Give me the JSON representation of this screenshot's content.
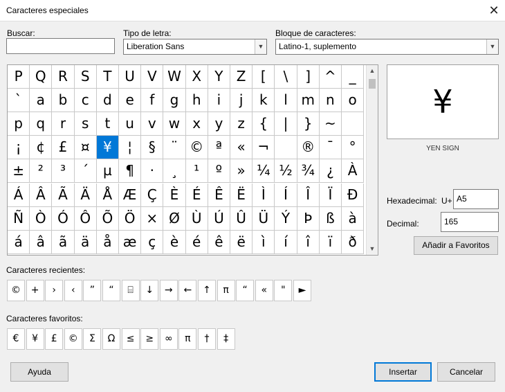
{
  "window": {
    "title": "Caracteres especiales"
  },
  "search": {
    "label": "Buscar:",
    "value": ""
  },
  "font": {
    "label": "Tipo de letra:",
    "value": "Liberation Sans"
  },
  "block": {
    "label": "Bloque de caracteres:",
    "value": "Latino-1, suplemento"
  },
  "grid": {
    "rows": [
      [
        "P",
        "Q",
        "R",
        "S",
        "T",
        "U",
        "V",
        "W",
        "X",
        "Y",
        "Z",
        "[",
        "\\",
        "]",
        "^",
        "_"
      ],
      [
        "`",
        "a",
        "b",
        "c",
        "d",
        "e",
        "f",
        "g",
        "h",
        "i",
        "j",
        "k",
        "l",
        "m",
        "n",
        "o"
      ],
      [
        "p",
        "q",
        "r",
        "s",
        "t",
        "u",
        "v",
        "w",
        "x",
        "y",
        "z",
        "{",
        "|",
        "}",
        "~",
        ""
      ],
      [
        "¡",
        "¢",
        "£",
        "¤",
        "¥",
        "¦",
        "§",
        "¨",
        "©",
        "ª",
        "«",
        "¬",
        "",
        "®",
        "¯",
        "°"
      ],
      [
        "±",
        "²",
        "³",
        "´",
        "µ",
        "¶",
        "·",
        "¸",
        "¹",
        "º",
        "»",
        "¼",
        "½",
        "¾",
        "¿",
        "À"
      ],
      [
        "Á",
        "Â",
        "Ã",
        "Ä",
        "Å",
        "Æ",
        "Ç",
        "È",
        "É",
        "Ê",
        "Ë",
        "Ì",
        "Í",
        "Î",
        "Ï",
        "Ð"
      ],
      [
        "Ñ",
        "Ò",
        "Ó",
        "Ô",
        "Õ",
        "Ö",
        "×",
        "Ø",
        "Ù",
        "Ú",
        "Û",
        "Ü",
        "Ý",
        "Þ",
        "ß",
        "à"
      ],
      [
        "á",
        "â",
        "ã",
        "ä",
        "å",
        "æ",
        "ç",
        "è",
        "é",
        "ê",
        "ë",
        "ì",
        "í",
        "î",
        "ï",
        "ð"
      ]
    ],
    "selected": {
      "row": 3,
      "col": 4
    }
  },
  "preview": {
    "char": "¥",
    "name": "YEN SIGN"
  },
  "hex": {
    "label": "Hexadecimal:",
    "prefix": "U+",
    "value": "A5"
  },
  "decimal": {
    "label": "Decimal:",
    "value": "165"
  },
  "buttons": {
    "add_favorite": "Añadir a Favoritos",
    "help": "Ayuda",
    "insert": "Insertar",
    "cancel": "Cancelar"
  },
  "recent": {
    "label": "Caracteres recientes:",
    "chars": [
      "©",
      "+",
      "›",
      "‹",
      "”",
      "“",
      "⌸",
      "↓",
      "→",
      "←",
      "↑",
      "π",
      "“",
      "«",
      "\"",
      "►"
    ]
  },
  "favorites": {
    "label": "Caracteres favoritos:",
    "chars": [
      "€",
      "¥",
      "£",
      "©",
      "Σ",
      "Ω",
      "≤",
      "≥",
      "∞",
      "π",
      "†",
      "‡"
    ]
  },
  "icons": {
    "close": "close-icon",
    "dropdown": "chevron-down-icon",
    "scroll_up": "chevron-up-icon",
    "scroll_down": "chevron-down-icon"
  }
}
